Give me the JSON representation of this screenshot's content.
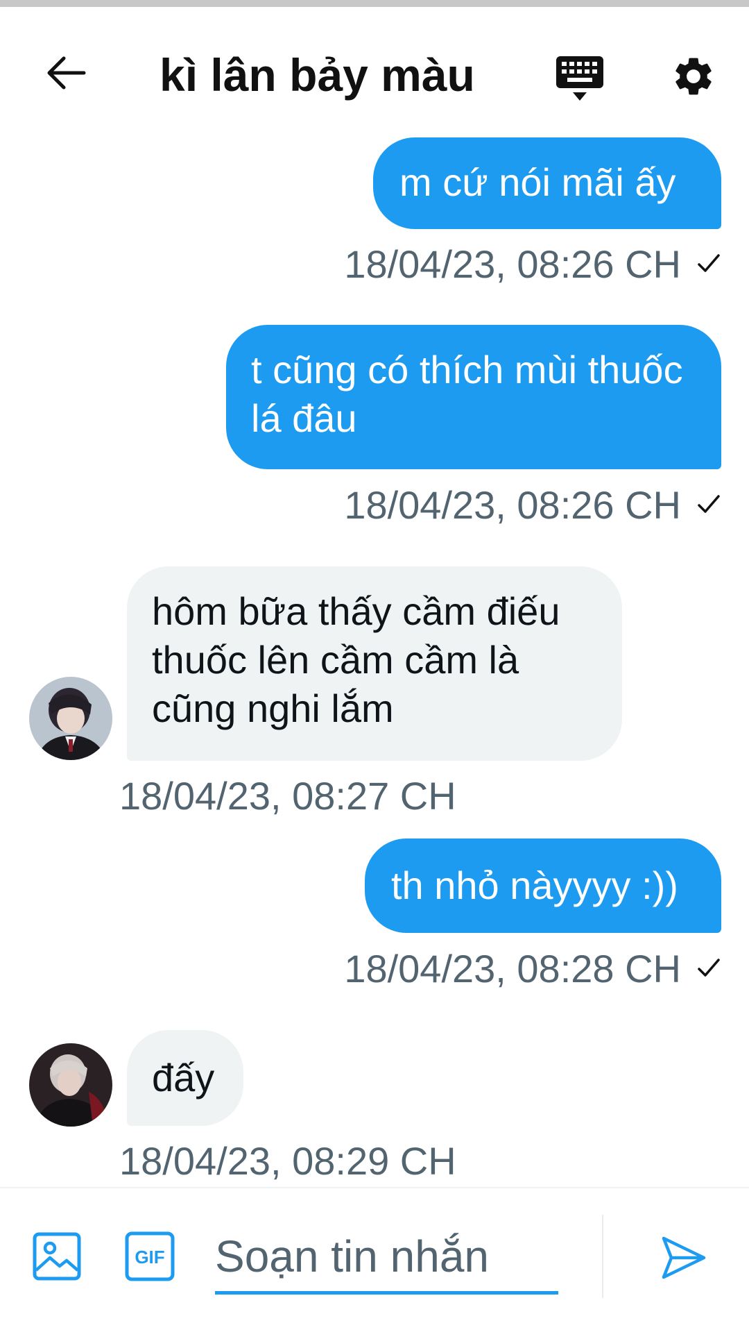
{
  "header": {
    "title": "kì lân bảy màu",
    "icons": {
      "back": "arrow-left-icon",
      "keyboard": "keyboard-icon",
      "settings": "gear-icon"
    }
  },
  "messages": [
    {
      "direction": "out",
      "text": "m cứ nói mãi ấy",
      "timestamp": "18/04/23, 08:26 CH",
      "status": "sent-check"
    },
    {
      "direction": "out",
      "text": "t cũng có thích mùi thuốc lá đâu",
      "timestamp": "18/04/23, 08:26 CH",
      "status": "sent-check"
    },
    {
      "direction": "in",
      "text": "hôm bữa thấy cầm điếu thuốc lên cầm cầm là cũng nghi lắm",
      "timestamp": "18/04/23, 08:27 CH"
    },
    {
      "direction": "out",
      "text": "th nhỏ nàyyyy :))",
      "timestamp": "18/04/23, 08:28 CH",
      "status": "sent-check"
    },
    {
      "direction": "in",
      "text": "đấy",
      "timestamp": "18/04/23, 08:29 CH"
    }
  ],
  "composer": {
    "placeholder": "Soạn tin nhắn",
    "gif_label": "GIF"
  },
  "colors": {
    "accent": "#1d9bf0",
    "incoming_bubble": "#eff3f4",
    "timestamp": "#536471"
  }
}
